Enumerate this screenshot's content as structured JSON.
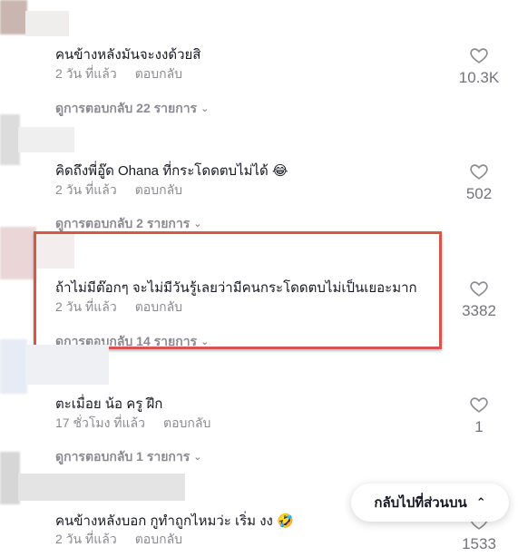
{
  "comments": [
    {
      "text": "คนข้างหลังมันจะงงด้วยสิ",
      "time": "2 วัน ที่แล้ว",
      "reply": "ตอบกลับ",
      "view_replies": "ดูการตอบกลับ 22 รายการ",
      "likes": "10.3K"
    },
    {
      "text": "คิดถึงพี่อู๊ด Ohana ที่กระโดดตบไม่ได้ 😂",
      "time": "2 วัน ที่แล้ว",
      "reply": "ตอบกลับ",
      "view_replies": "ดูการตอบกลับ 2 รายการ",
      "likes": "502"
    },
    {
      "text": "ถ้าไม่มีต๊อกๆ จะไม่มีวันรู้เลยว่ามีคนกระโดดตบไม่เป็นเยอะมาก",
      "time": "2 วัน ที่แล้ว",
      "reply": "ตอบกลับ",
      "view_replies": "ดูการตอบกลับ 14 รายการ",
      "likes": "3382"
    },
    {
      "text": "ตะเมื่อย น้อ ครู ฝึก",
      "time": "17 ชั่วโมง ที่แล้ว",
      "reply": "ตอบกลับ",
      "view_replies": "ดูการตอบกลับ 1 รายการ",
      "likes": "1"
    },
    {
      "text": "คนข้างหลังบอก กูทำถูกไหมว่ะ เริ่ม งง 🤣",
      "time": "2 วัน ที่แล้ว",
      "reply": "ตอบกลับ",
      "likes": "1533"
    }
  ],
  "back_to_top": "กลับไปที่ส่วนบน",
  "icons": {
    "like": "heart-outline-icon",
    "expand": "chevron-down-icon",
    "back_top": "double-chevron-up-icon"
  },
  "colors": {
    "highlight": "#d9534f",
    "muted": "#8a8b91",
    "text": "#161823"
  }
}
